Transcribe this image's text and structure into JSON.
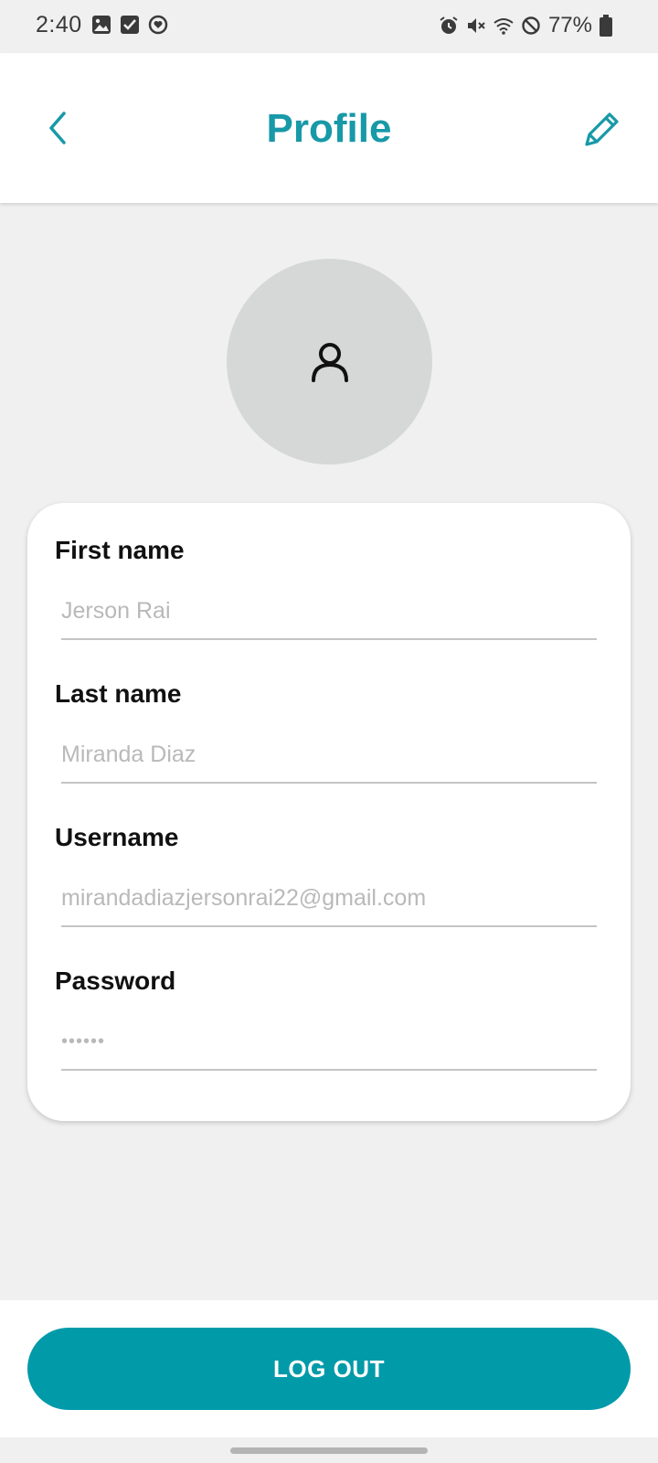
{
  "status_bar": {
    "time": "2:40",
    "left_icons": [
      "image-icon",
      "checkbox-icon",
      "heart-circle-icon"
    ],
    "right_icons": [
      "alarm-icon",
      "mute-icon",
      "wifi-icon",
      "do-not-disturb-icon"
    ],
    "battery_percent": "77%"
  },
  "app_bar": {
    "title": "Profile",
    "back_icon": "chevron-left-icon",
    "edit_icon": "pencil-icon"
  },
  "avatar": {
    "icon": "person-icon"
  },
  "form": {
    "first_name": {
      "label": "First name",
      "value": "Jerson Rai"
    },
    "last_name": {
      "label": "Last name",
      "value": "Miranda Diaz"
    },
    "username": {
      "label": "Username",
      "value": "mirandadiazjersonrai22@gmail.com"
    },
    "password": {
      "label": "Password",
      "value": "••••••"
    }
  },
  "actions": {
    "logout_label": "LOG OUT"
  },
  "colors": {
    "accent": "#1799a8",
    "button": "#019aa9",
    "background": "#f0f0f0",
    "avatar_bg": "#d6d8d8"
  }
}
